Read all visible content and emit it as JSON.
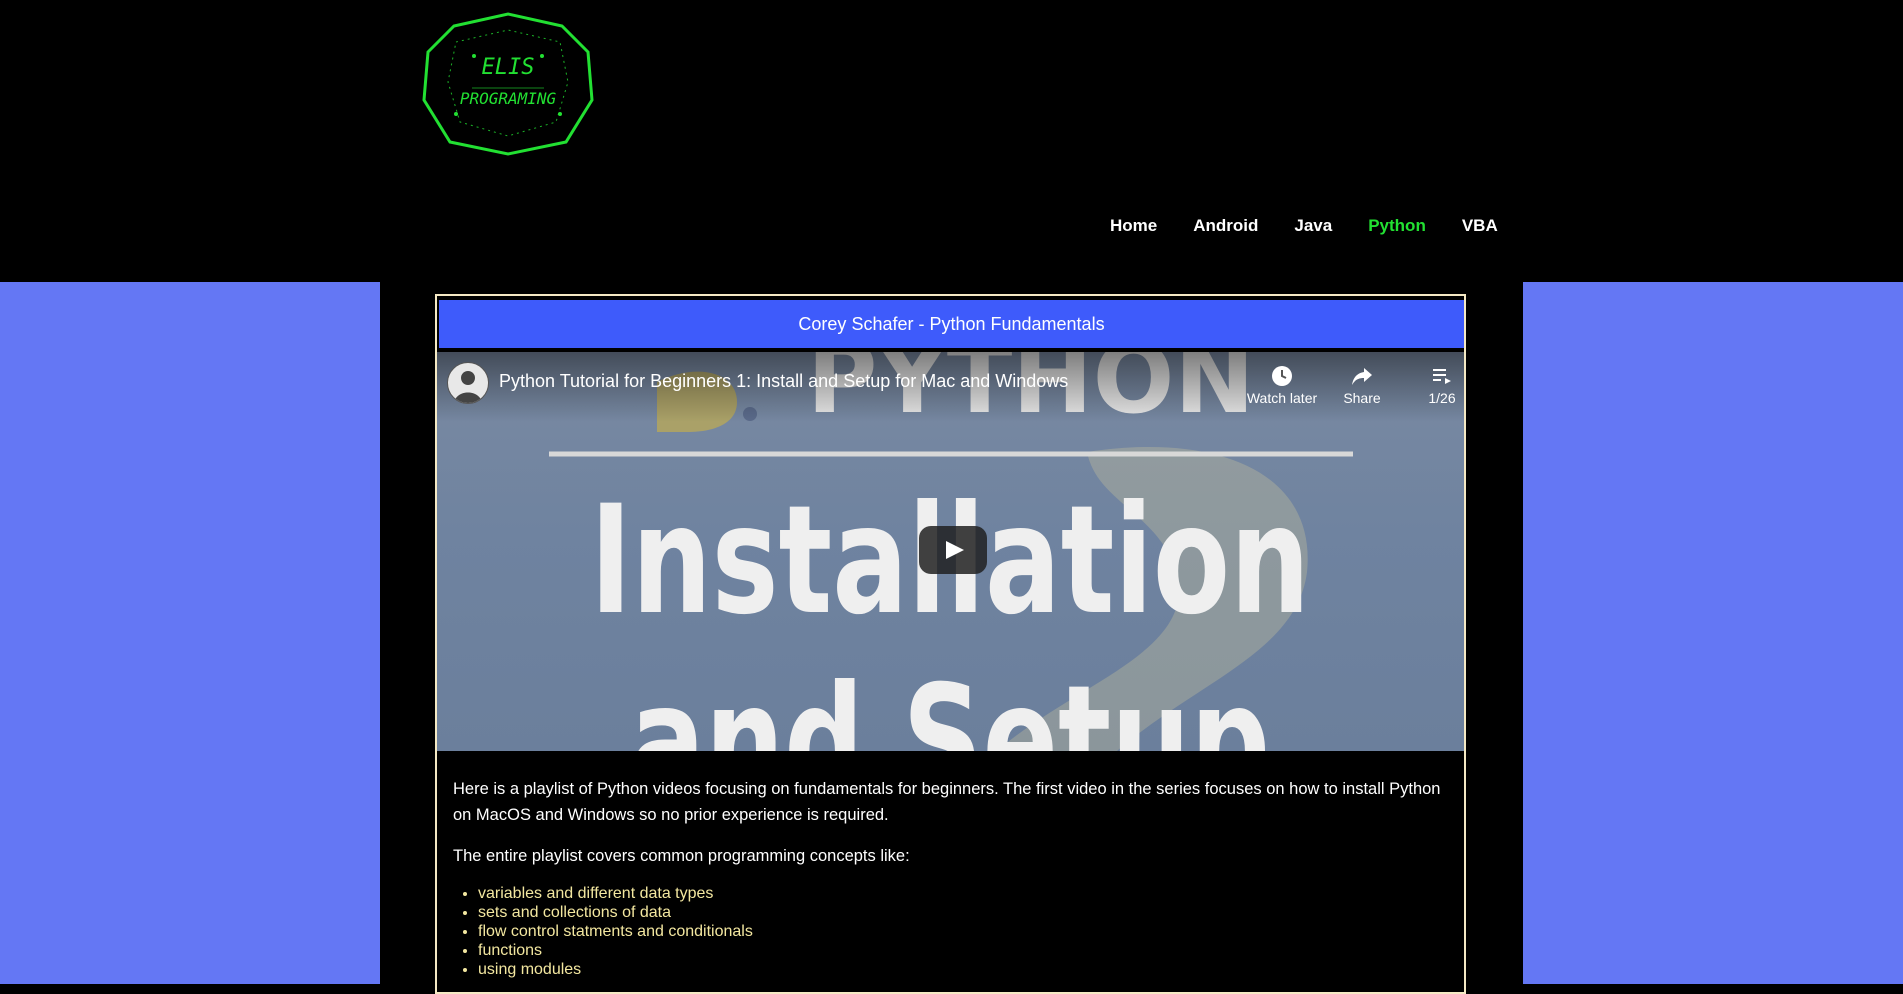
{
  "logo": {
    "line1": "ELIS",
    "line2": "PROGRAMING",
    "color": "#22e032"
  },
  "nav": {
    "items": [
      {
        "label": "Home",
        "active": false
      },
      {
        "label": "Android",
        "active": false
      },
      {
        "label": "Java",
        "active": false
      },
      {
        "label": "Python",
        "active": true
      },
      {
        "label": "VBA",
        "active": false
      }
    ],
    "active_color": "#22e032"
  },
  "colors": {
    "side_background": "#6477f4",
    "card_title_background": "#3e5bfb",
    "card_border": "#f5e9c4",
    "bullet_text": "#f3e7a0"
  },
  "card": {
    "title": "Corey Schafer - Python Fundamentals"
  },
  "video": {
    "title": "Python Tutorial for Beginners 1: Install and Setup for Mac and Windows",
    "thumbnail_word_top": "PYTHON",
    "thumbnail_line1": "Installation",
    "thumbnail_line2": "and Setup",
    "watch_later_label": "Watch later",
    "share_label": "Share",
    "playlist_position": "1/26",
    "icons": [
      "clock-icon",
      "share-icon",
      "playlist-icon",
      "play-icon"
    ]
  },
  "description": {
    "paragraph1": "Here is a playlist of Python videos focusing on fundamentals for beginners. The first video in the series focuses on how to install Python on MacOS and Windows so no prior experience is required.",
    "paragraph2": "The entire playlist covers common programming concepts like:",
    "bullets": [
      "variables and different data types",
      "sets and collections of data",
      "flow control statments and conditionals",
      "functions",
      "using modules"
    ]
  }
}
